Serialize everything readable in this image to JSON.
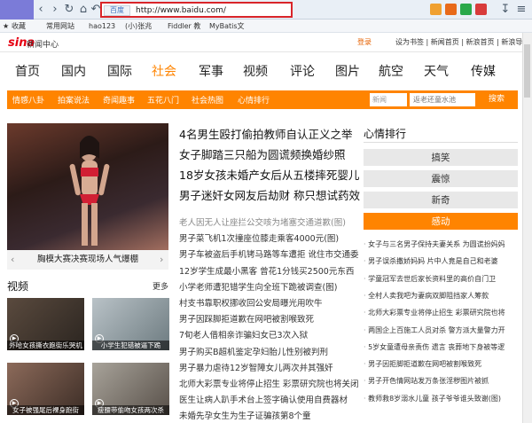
{
  "browser": {
    "url": "http://www.baidu.com/",
    "engine_tag": "百度",
    "bookmarks_label": "收藏",
    "bookmarks": [
      "常用网站",
      "hao123",
      "(小)张兆",
      "Fiddler 教",
      "MyBatis文"
    ]
  },
  "site": {
    "logo": "sina",
    "logo_text": "新闻中心",
    "login": "登录",
    "top_links": "设为书签 | 新闻首页 | 新浪首页 | 新浪导航"
  },
  "nav": [
    "首页",
    "国内",
    "国际",
    "社会",
    "军事",
    "视频",
    "评论",
    "图片",
    "航空",
    "天气",
    "传媒"
  ],
  "active_nav": "社会",
  "subnav": [
    "情感八卦",
    "拍案说法",
    "奇闻趣事",
    "五花八门",
    "社会热图",
    "心情排行"
  ],
  "search": {
    "select": "新闻",
    "placeholder": "返老还童水池",
    "button": "搜索"
  },
  "hero": {
    "caption": "胸模大赛决赛现场人气爆棚"
  },
  "headlines": [
    "4名男生殴打偷拍教师自认正义之举",
    "女子脚踏三只船为圆谎频换婚纱照",
    "18岁女孩未婚产女后从五楼摔死婴儿",
    "男子迷奸女网友后劫财 称只想试药效"
  ],
  "news_list": [
    "老人因无人让座拦公交咳为堵塞交通道歉(图)",
    "男子菜飞机1次撞座位膝走乘客4000元(图)",
    "男子车被盗后手机铐马路等车遭拒 讹住市交通委",
    "12岁学生成最小黑客 曾花1分钱买2500元东西",
    "小学老师遭犯错学生向全班下跪被调查(图)",
    "村支书靠职权挪收回公安局曝光用吹牛",
    "男子因踩脚拒道歉在网吧被割喉致死",
    "7旬老人借相亲诈骗妇女已3次入狱",
    "男子购买B超机鉴定孕妇胎儿性别被判刑",
    "男子暴力虐待12岁智障女儿两次并其强奸",
    "北师大彩票专业将停止招生 彩票研究院也将关闭",
    "医生让病人趴手术台上签字确认使用自费器材",
    "未婚先孕女生为生子证骗孩第8个童"
  ],
  "video": {
    "title": "视频",
    "more": "更多",
    "items": [
      "外哈女孩撕衣跑街乐哭机",
      "小学生犯错被逼下跪",
      "女子被强尾后裸身跑街",
      "瘦腰带偷吻女孩两次杀"
    ]
  },
  "mood": {
    "title": "心情排行",
    "tabs": [
      "搞笑",
      "震惊",
      "新奇",
      "感动"
    ],
    "active": "感动",
    "list": [
      "女子与三名男子保持夫妻关系 为圆谎扮妈妈",
      "男子误杀撒娇妈妈 片中人竟是自己和老婆",
      "学童冠军去世后家长资料里的高价自门卫",
      "全村人卖我吧为妻病双脚阻挡家人筹款",
      "北师大彩票专业将停止招生 彩票研究院也将",
      "两国企上百施工人员对杀 警方派大量警力开",
      "5岁女童遭母亲责伤 遗言 丧葬地下身被等逻",
      "男子因拒脚拒道歉在网吧被割喉致死",
      "男子开色情网站发万条张淫秽图片被抓",
      "教师救8岁溺水儿童 孩子爷爷谁头致谢(图)"
    ]
  },
  "colors": {
    "accent": "#ff8400",
    "brand": "#e60012",
    "highlight_border": "#d9252a"
  }
}
